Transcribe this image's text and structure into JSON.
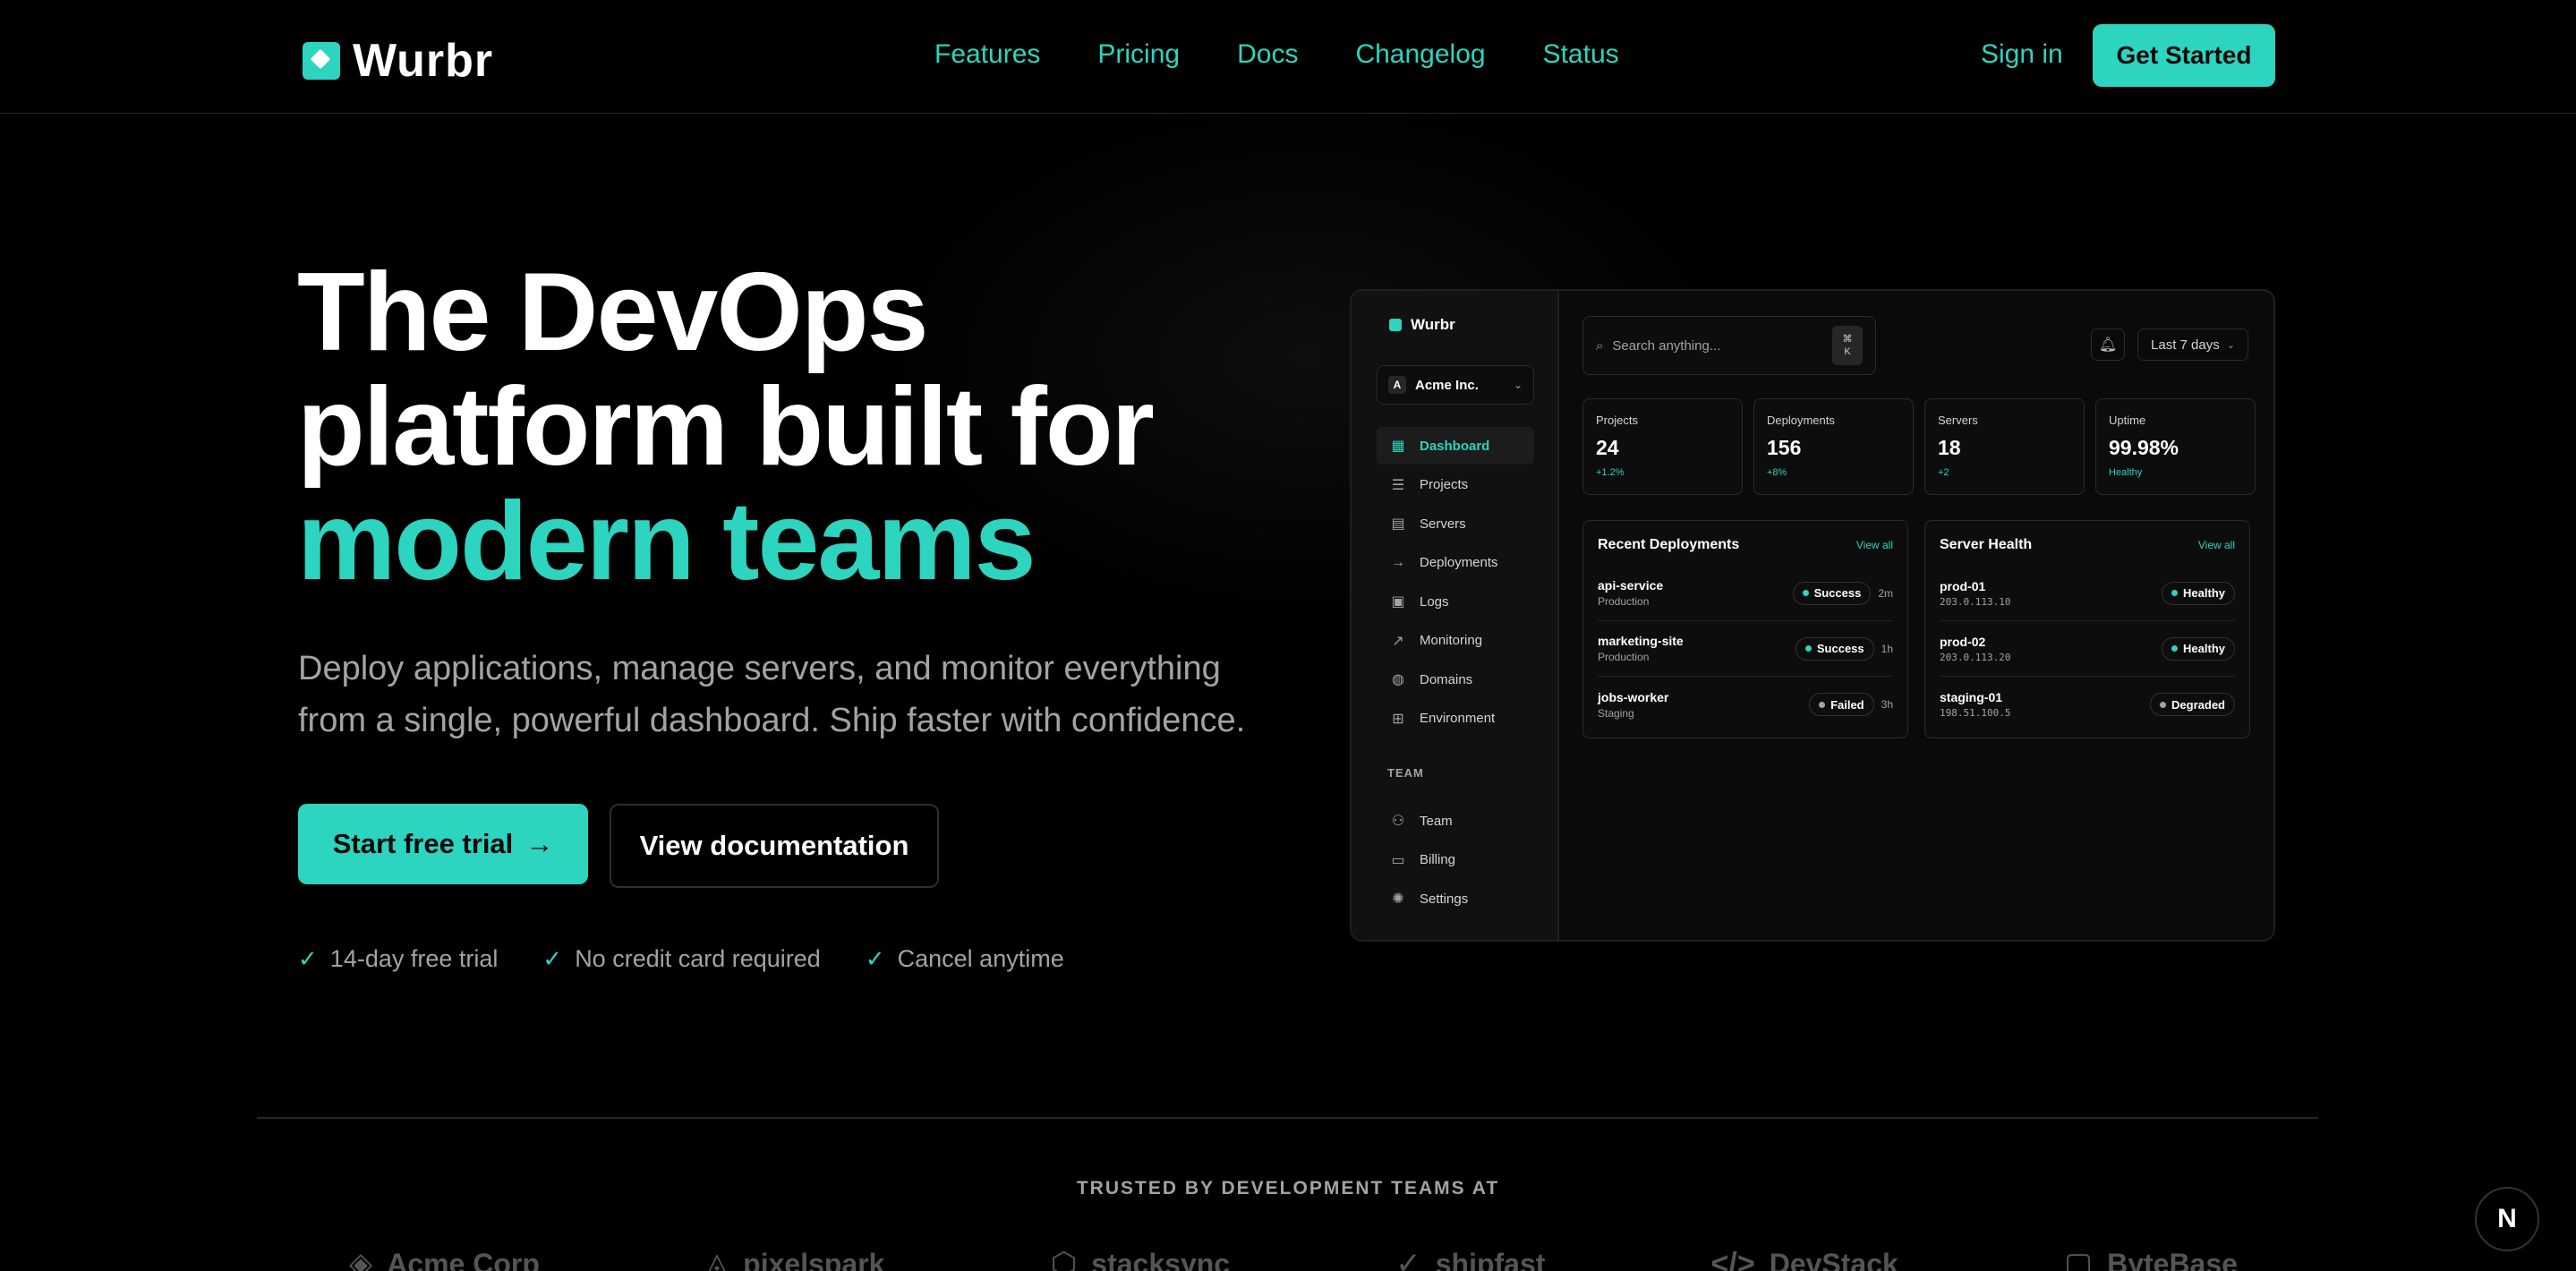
{
  "brand": {
    "name": "Wurbr",
    "accent": "#2dd4bf"
  },
  "nav": {
    "links": [
      "Features",
      "Pricing",
      "Docs",
      "Changelog",
      "Status"
    ],
    "signin": "Sign in",
    "cta": "Get Started"
  },
  "hero": {
    "title_line1": "The DevOps",
    "title_line2": "platform built for",
    "title_accent": "modern teams",
    "subtitle": "Deploy applications, manage servers, and monitor everything from a single, powerful dashboard. Ship faster with confidence.",
    "primary_cta": "Start free trial",
    "primary_arrow": "→",
    "secondary_cta": "View documentation",
    "checks": [
      "14-day free trial",
      "No credit card required",
      "Cancel anytime"
    ]
  },
  "dashboard": {
    "brand": "Wurbr",
    "org": {
      "initial": "A",
      "name": "Acme Inc."
    },
    "menu": [
      {
        "label": "Dashboard",
        "icon": "grid-icon",
        "glyph": "▦",
        "active": true
      },
      {
        "label": "Projects",
        "icon": "list-icon",
        "glyph": "☰"
      },
      {
        "label": "Servers",
        "icon": "server-icon",
        "glyph": "▤"
      },
      {
        "label": "Deployments",
        "icon": "arrow-right-icon",
        "glyph": "→"
      },
      {
        "label": "Logs",
        "icon": "log-icon",
        "glyph": "▣"
      },
      {
        "label": "Monitoring",
        "icon": "chart-line-icon",
        "glyph": "↗"
      },
      {
        "label": "Domains",
        "icon": "globe-icon",
        "glyph": "◍"
      },
      {
        "label": "Environment",
        "icon": "env-grid-icon",
        "glyph": "⊞"
      }
    ],
    "team_label": "TEAM",
    "team_menu": [
      {
        "label": "Team",
        "icon": "users-icon",
        "glyph": "⚇"
      },
      {
        "label": "Billing",
        "icon": "card-icon",
        "glyph": "▭"
      },
      {
        "label": "Settings",
        "icon": "gear-icon",
        "glyph": "✺"
      }
    ],
    "search": {
      "placeholder": "Search anything...",
      "kbd_top": "⌘",
      "kbd_bottom": "K"
    },
    "range": "Last 7 days",
    "stats": [
      {
        "label": "Projects",
        "value": "24",
        "delta": "+1.2%"
      },
      {
        "label": "Deployments",
        "value": "156",
        "delta": "+8%"
      },
      {
        "label": "Servers",
        "value": "18",
        "delta": "+2"
      },
      {
        "label": "Uptime",
        "value": "99.98%",
        "delta": "Healthy"
      }
    ],
    "deployments": {
      "title": "Recent Deployments",
      "view_all": "View all",
      "rows": [
        {
          "name": "api-service",
          "env": "Production",
          "status": "Success",
          "age": "2m"
        },
        {
          "name": "marketing-site",
          "env": "Production",
          "status": "Success",
          "age": "1h"
        },
        {
          "name": "jobs-worker",
          "env": "Staging",
          "status": "Failed",
          "age": "3h"
        }
      ]
    },
    "health": {
      "title": "Server Health",
      "view_all": "View all",
      "rows": [
        {
          "name": "prod-01",
          "ip": "203.0.113.10",
          "status": "Healthy"
        },
        {
          "name": "prod-02",
          "ip": "203.0.113.20",
          "status": "Healthy"
        },
        {
          "name": "staging-01",
          "ip": "198.51.100.5",
          "status": "Degraded"
        }
      ]
    }
  },
  "trusted": {
    "label": "TRUSTED BY DEVELOPMENT TEAMS AT",
    "logos": [
      {
        "name": "Acme Corp",
        "icon": "layers-icon",
        "glyph": "◈"
      },
      {
        "name": "pixelspark",
        "icon": "triangle-circle-icon",
        "glyph": "◬"
      },
      {
        "name": "stacksync",
        "icon": "hexagon-icon",
        "glyph": "⬡"
      },
      {
        "name": "shipfast",
        "icon": "check-circle-icon",
        "glyph": "✓"
      },
      {
        "name": "DevStack",
        "icon": "code-icon",
        "glyph": "</>"
      },
      {
        "name": "ByteBase",
        "icon": "square-icon",
        "glyph": "▢"
      }
    ]
  },
  "corner_badge": "N"
}
